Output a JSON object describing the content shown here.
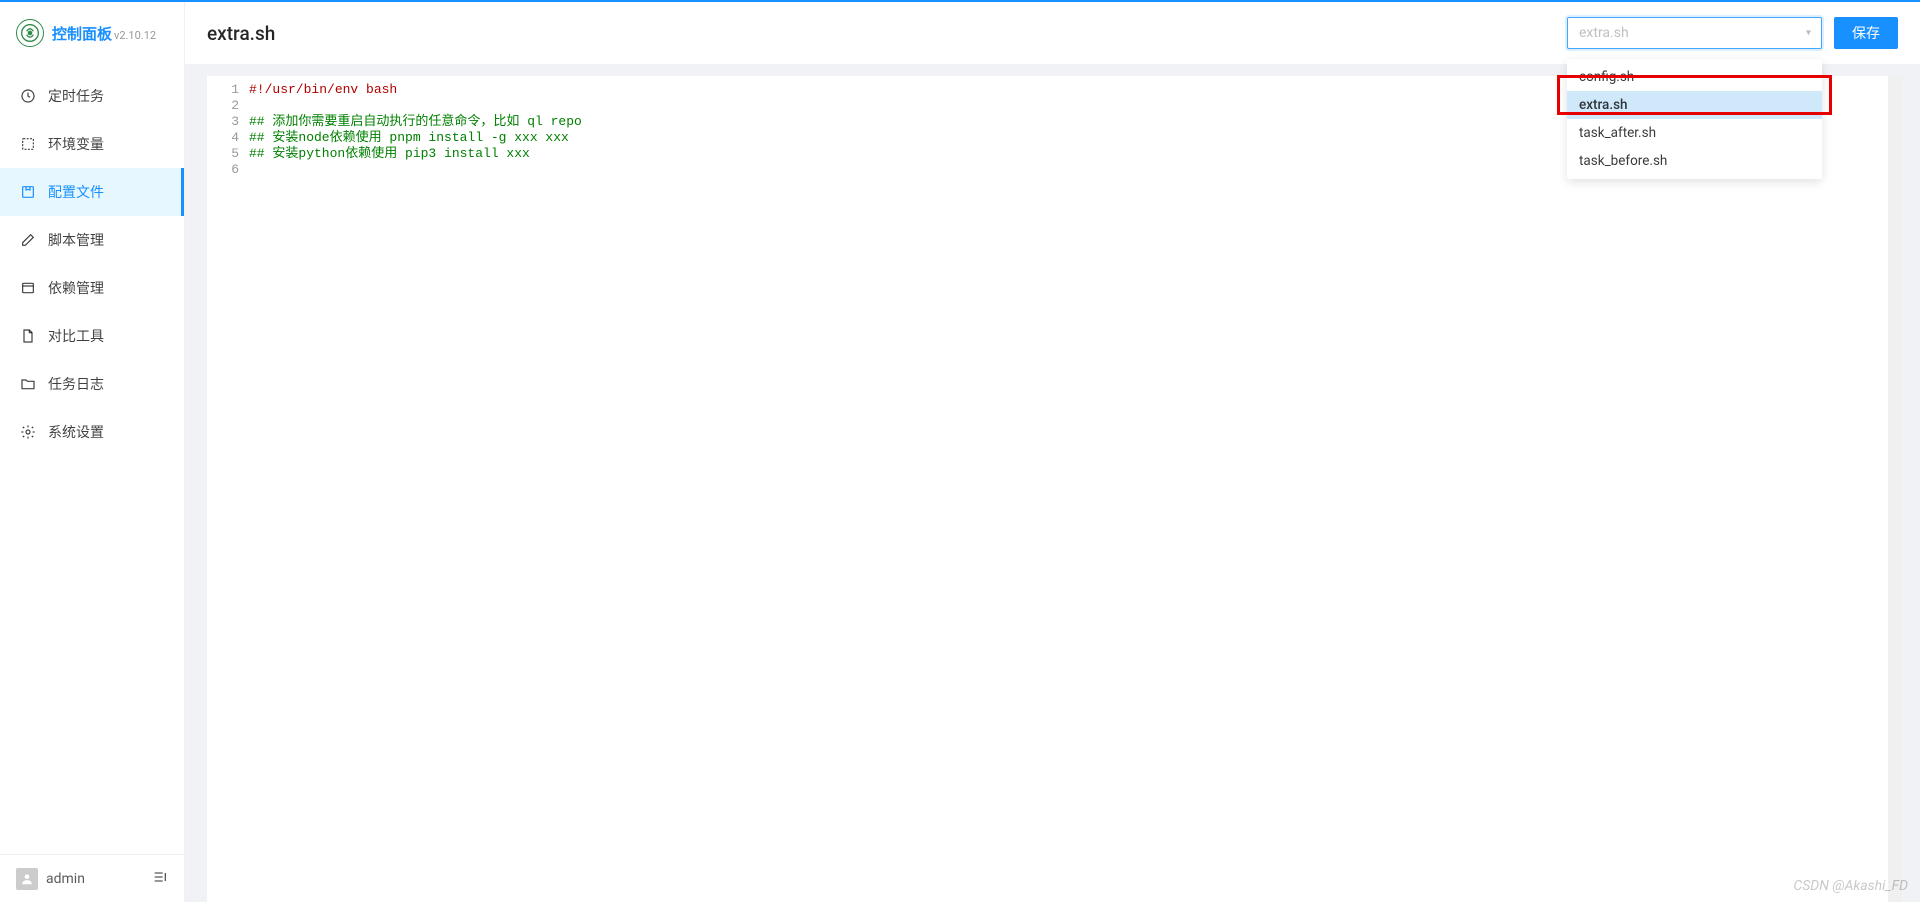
{
  "app": {
    "title": "控制面板",
    "version": "v2.10.12"
  },
  "sidebar": {
    "items": [
      {
        "icon": "clock",
        "label": "定时任务"
      },
      {
        "icon": "brackets",
        "label": "环境变量"
      },
      {
        "icon": "file-box",
        "label": "配置文件"
      },
      {
        "icon": "edit",
        "label": "脚本管理"
      },
      {
        "icon": "container",
        "label": "依赖管理"
      },
      {
        "icon": "file",
        "label": "对比工具"
      },
      {
        "icon": "folder",
        "label": "任务日志"
      },
      {
        "icon": "gear",
        "label": "系统设置"
      }
    ],
    "active_index": 2,
    "user": "admin"
  },
  "header": {
    "page_title": "extra.sh",
    "select_value": "extra.sh",
    "save_label": "保存",
    "dropdown_options": [
      "config.sh",
      "extra.sh",
      "task_after.sh",
      "task_before.sh"
    ],
    "dropdown_selected_index": 1
  },
  "editor": {
    "lines": [
      {
        "num": 1,
        "cls": "tok-red",
        "text": "#!/usr/bin/env bash"
      },
      {
        "num": 2,
        "cls": "",
        "text": ""
      },
      {
        "num": 3,
        "cls": "tok-green",
        "text": "## 添加你需要重启自动执行的任意命令，比如 ql repo"
      },
      {
        "num": 4,
        "cls": "tok-green",
        "text": "## 安装node依赖使用 pnpm install -g xxx xxx"
      },
      {
        "num": 5,
        "cls": "tok-green",
        "text": "## 安装python依赖使用 pip3 install xxx"
      },
      {
        "num": 6,
        "cls": "",
        "text": ""
      }
    ]
  },
  "watermark": "CSDN @Akashi_FD"
}
